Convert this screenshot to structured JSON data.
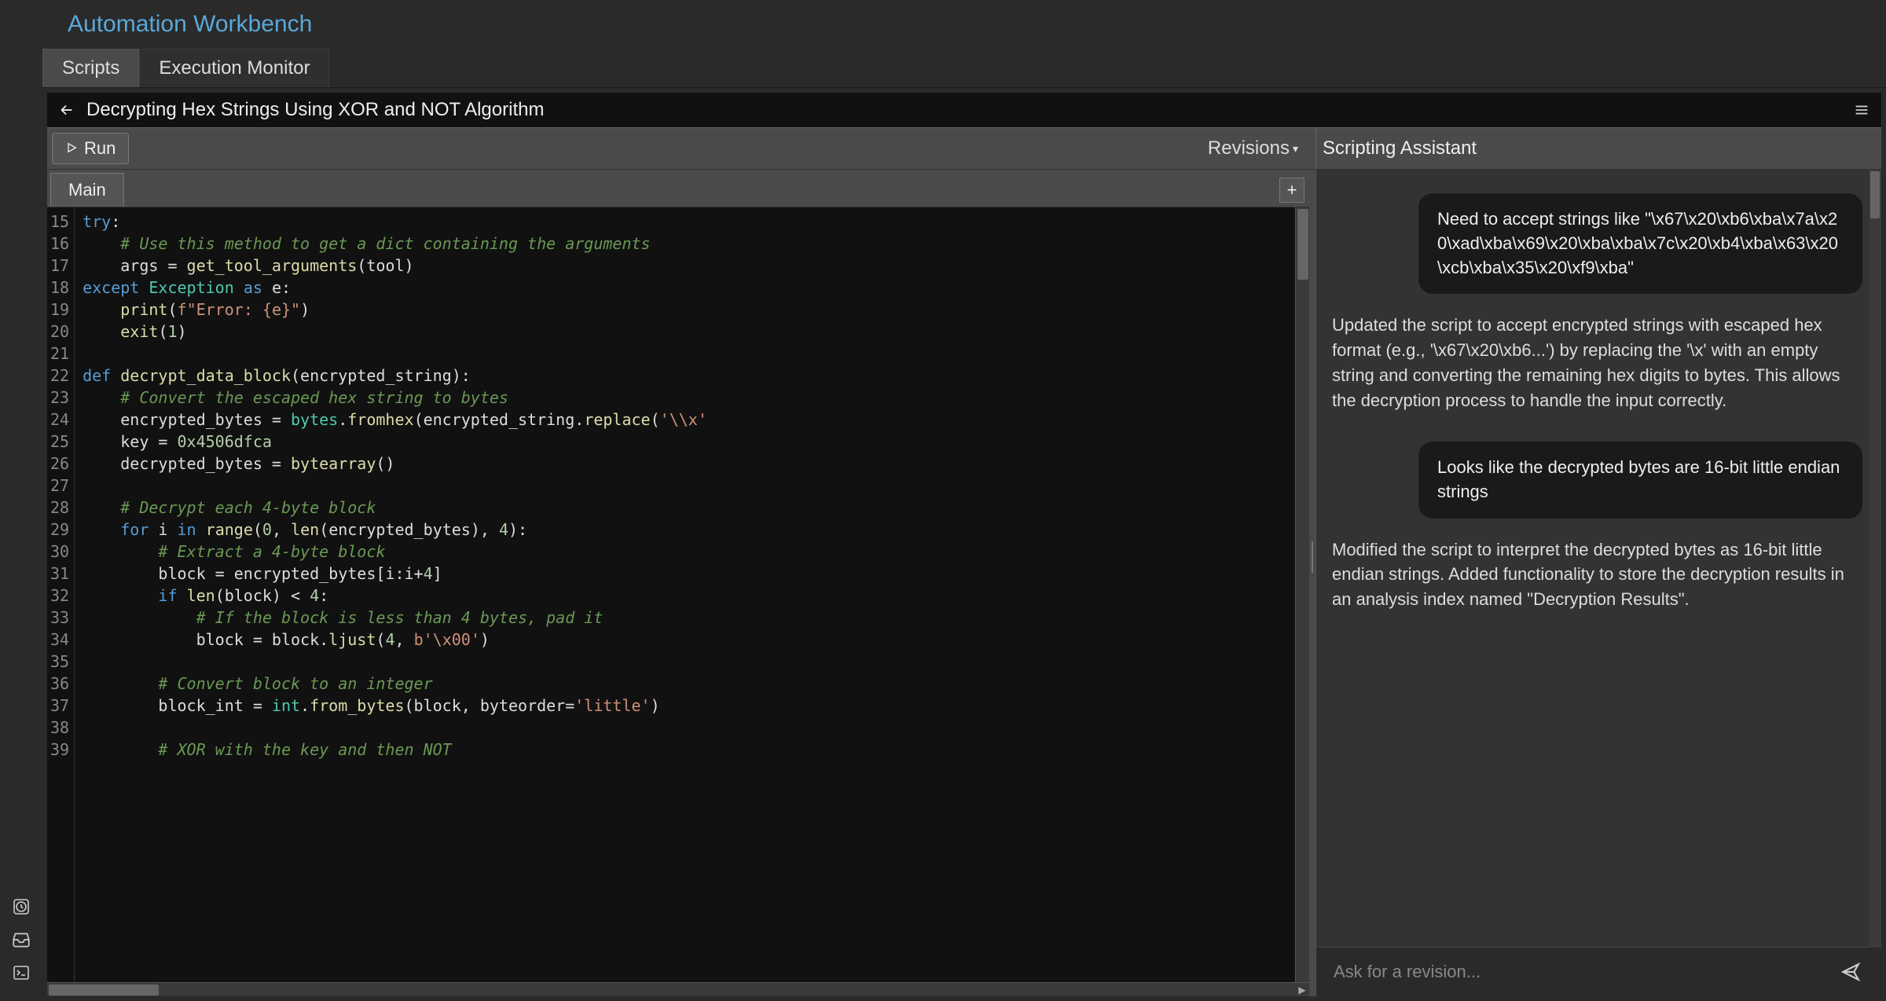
{
  "app_title": "Automation Workbench",
  "top_tabs": {
    "scripts": "Scripts",
    "monitor": "Execution Monitor"
  },
  "breadcrumb": {
    "title": "Decrypting Hex Strings Using XOR and NOT Algorithm"
  },
  "toolbar": {
    "run_label": "Run",
    "revisions_label": "Revisions"
  },
  "assistant": {
    "title": "Scripting Assistant",
    "input_placeholder": "Ask for a revision...",
    "messages": [
      {
        "role": "user",
        "text": "Need to accept strings like \"\\x67\\x20\\xb6\\xba\\x7a\\x20\\xad\\xba\\x69\\x20\\xba\\xba\\x7c\\x20\\xb4\\xba\\x63\\x20\\xcb\\xba\\x35\\x20\\xf9\\xba\""
      },
      {
        "role": "assistant",
        "text": "Updated the script to accept encrypted strings with escaped hex format (e.g., '\\x67\\x20\\xb6...') by replacing the '\\x' with an empty string and converting the remaining hex digits to bytes. This allows the decryption process to handle the input correctly."
      },
      {
        "role": "user",
        "text": "Looks like the decrypted bytes are 16-bit little endian strings"
      },
      {
        "role": "assistant",
        "text": "Modified the script to interpret the decrypted bytes as 16-bit little endian strings. Added functionality to store the decryption results in an analysis index named \"Decryption Results\"."
      }
    ]
  },
  "editor": {
    "tab_main": "Main",
    "first_line_no": 15,
    "lines": [
      {
        "n": 15,
        "html": "<span class='kw'>try</span>:"
      },
      {
        "n": 16,
        "html": "    <span class='cmt'># Use this method to get a dict containing the arguments</span>"
      },
      {
        "n": 17,
        "html": "    args = <span class='fn'>get_tool_arguments</span>(tool)"
      },
      {
        "n": 18,
        "html": "<span class='kw'>except</span> <span class='builtin'>Exception</span> <span class='kw'>as</span> e:"
      },
      {
        "n": 19,
        "html": "    <span class='fn'>print</span>(<span class='str'>f\"Error: {e}\"</span>)"
      },
      {
        "n": 20,
        "html": "    <span class='fn'>exit</span>(<span class='num'>1</span>)"
      },
      {
        "n": 21,
        "html": ""
      },
      {
        "n": 22,
        "html": "<span class='kw'>def</span> <span class='fn'>decrypt_data_block</span>(encrypted_string):"
      },
      {
        "n": 23,
        "html": "    <span class='cmt'># Convert the escaped hex string to bytes</span>"
      },
      {
        "n": 24,
        "html": "    encrypted_bytes = <span class='builtin'>bytes</span>.<span class='fn'>fromhex</span>(encrypted_string.<span class='fn'>replace</span>(<span class='str'>'\\\\x'</span>"
      },
      {
        "n": 25,
        "html": "    key = <span class='num'>0x4506dfca</span>"
      },
      {
        "n": 26,
        "html": "    decrypted_bytes = <span class='fn'>bytearray</span>()"
      },
      {
        "n": 27,
        "html": ""
      },
      {
        "n": 28,
        "html": "    <span class='cmt'># Decrypt each 4-byte block</span>"
      },
      {
        "n": 29,
        "html": "    <span class='kw'>for</span> i <span class='kw'>in</span> <span class='fn'>range</span>(<span class='num'>0</span>, <span class='fn'>len</span>(encrypted_bytes), <span class='num'>4</span>):"
      },
      {
        "n": 30,
        "html": "        <span class='cmt'># Extract a 4-byte block</span>"
      },
      {
        "n": 31,
        "html": "        block = encrypted_bytes[i:i+<span class='num'>4</span>]"
      },
      {
        "n": 32,
        "html": "        <span class='kw'>if</span> <span class='fn'>len</span>(block) &lt; <span class='num'>4</span>:"
      },
      {
        "n": 33,
        "html": "            <span class='cmt'># If the block is less than 4 bytes, pad it</span>"
      },
      {
        "n": 34,
        "html": "            block = block.<span class='fn'>ljust</span>(<span class='num'>4</span>, <span class='str'>b'\\x00'</span>)"
      },
      {
        "n": 35,
        "html": ""
      },
      {
        "n": 36,
        "html": "        <span class='cmt'># Convert block to an integer</span>"
      },
      {
        "n": 37,
        "html": "        block_int = <span class='builtin'>int</span>.<span class='fn'>from_bytes</span>(block, byteorder=<span class='str'>'little'</span>)"
      },
      {
        "n": 38,
        "html": ""
      },
      {
        "n": 39,
        "html": "        <span class='cmt'># XOR with the key and then NOT</span>"
      }
    ]
  }
}
